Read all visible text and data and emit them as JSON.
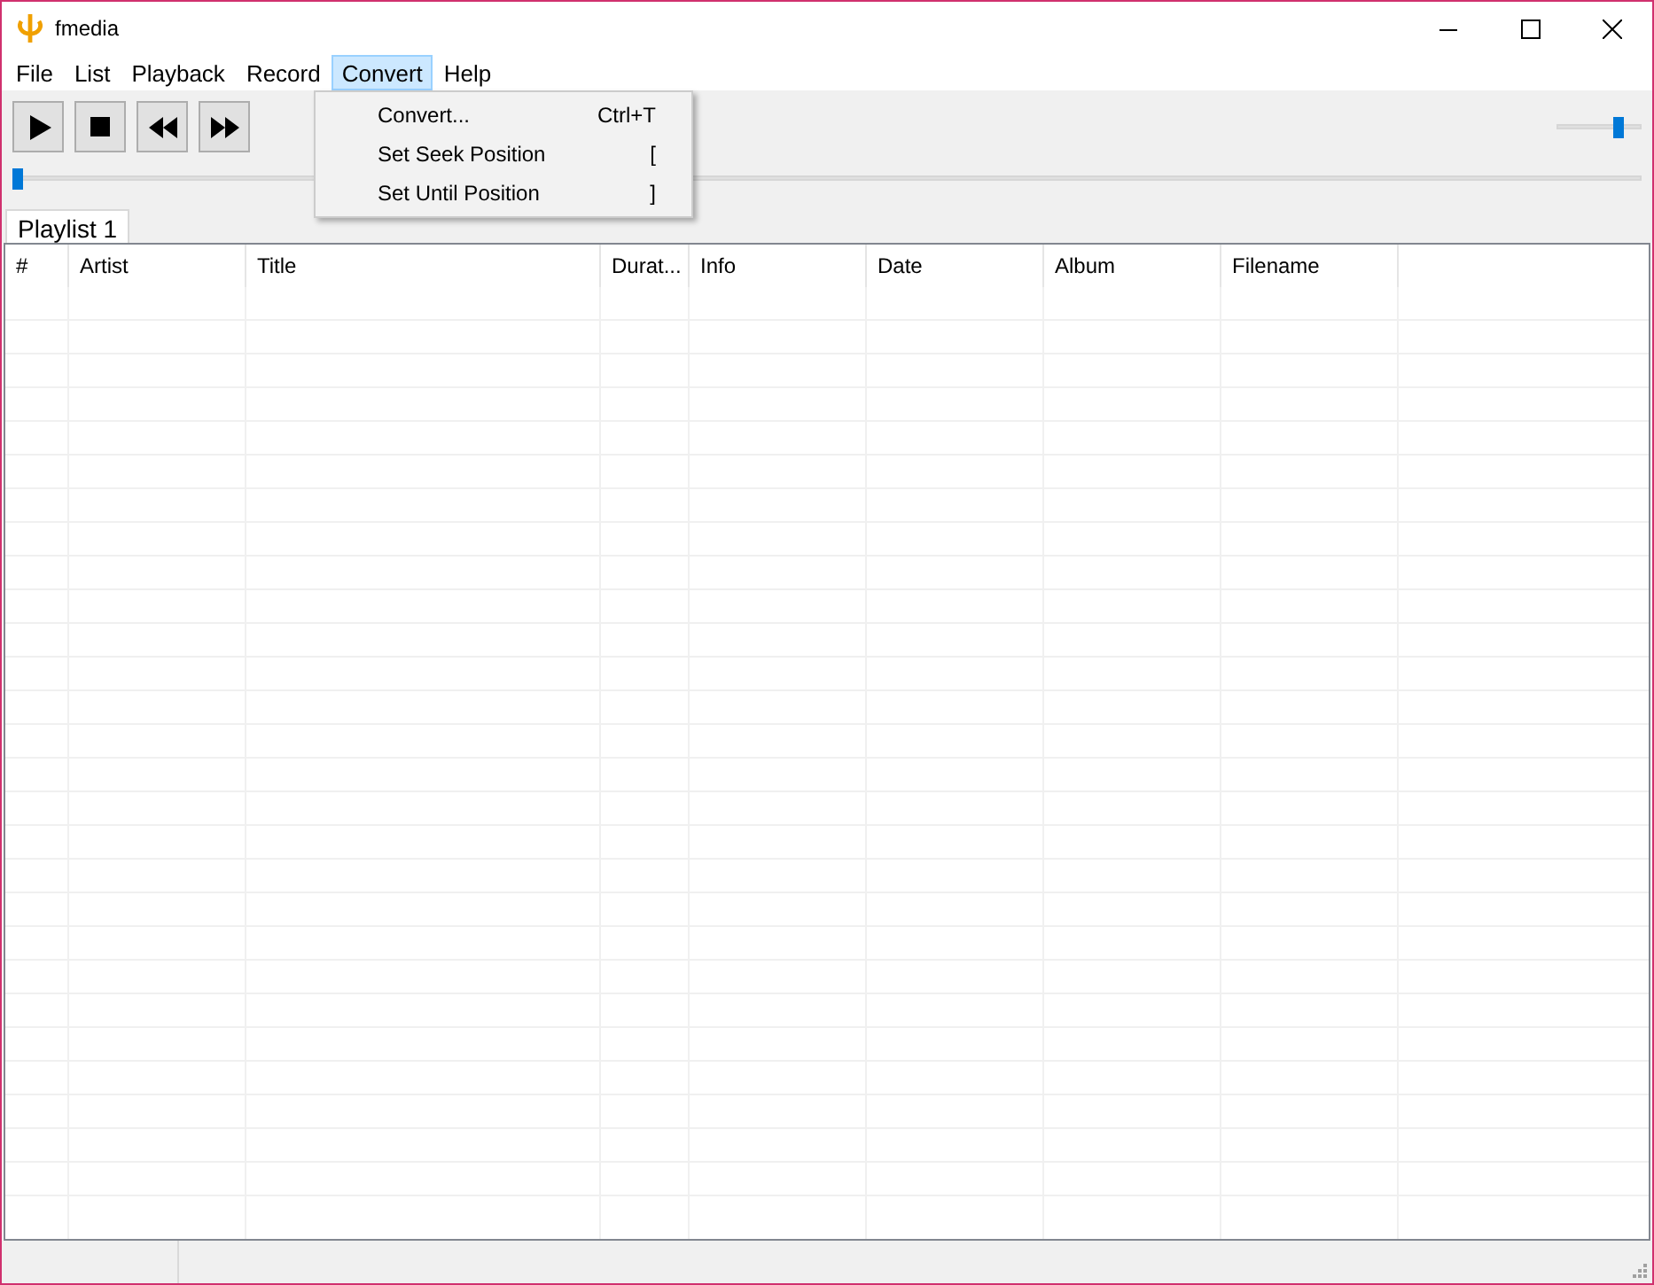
{
  "window": {
    "title": "fmedia"
  },
  "menu": [
    {
      "label": "File",
      "selected": false
    },
    {
      "label": "List",
      "selected": false
    },
    {
      "label": "Playback",
      "selected": false
    },
    {
      "label": "Record",
      "selected": false
    },
    {
      "label": "Convert",
      "selected": true
    },
    {
      "label": "Help",
      "selected": false
    }
  ],
  "dropdown": [
    {
      "label": "Convert...",
      "shortcut": "Ctrl+T"
    },
    {
      "label": "Set Seek Position",
      "shortcut": "["
    },
    {
      "label": "Set Until Position",
      "shortcut": "]"
    }
  ],
  "volume": {
    "level": 0.75
  },
  "seek": {
    "level": 0
  },
  "tabs": [
    {
      "label": "Playlist 1",
      "selected": true
    }
  ],
  "table": {
    "columns": [
      "#",
      "Artist",
      "Title",
      "Durat...",
      "Info",
      "Date",
      "Album",
      "Filename"
    ]
  }
}
